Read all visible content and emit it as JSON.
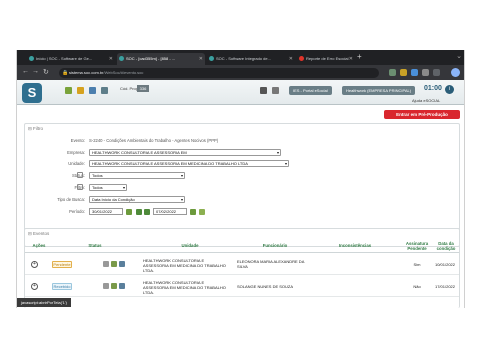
{
  "browser": {
    "tabs": [
      {
        "label": "Início | SOC - Software de Ge..."
      },
      {
        "label": "SOC - [cad355m] - [858 - ..."
      },
      {
        "label": "SOC - Software Integrado de..."
      },
      {
        "label": "Reporte de Erro Esocial"
      }
    ],
    "url_host": "sistema.soc.com.br",
    "url_path": "/WebSoc/#/evento.soc"
  },
  "header": {
    "logo_letter": "S",
    "cod_prog_label": "Cód. Prog.",
    "cod_prog_value": "336",
    "esocial_label": "IES - Portal eSocial",
    "company_label": "Healthwork (EMPRESA PRINCIPAL)",
    "clock": "01:00",
    "help_link": "Ajuda eSOCIAL"
  },
  "actions": {
    "entrar_button": "Entrar em Pré-Produção"
  },
  "filter": {
    "title": "Filtro",
    "evento_label": "Evento:",
    "evento_value": "S-2240 - Condições Ambientais do Trabalho - Agentes Nocivos (PPP)",
    "empresa_label": "Empresa:",
    "empresa_value": "HEALTHWORK CONSULTORIA E ASSESSORIA EM",
    "unidade_label": "Unidade:",
    "unidade_value": "HEALTHWORK CONSULTORIA E ASSESSORIA EM MEDICINA DO TRABALHO LTDA",
    "status_label": "Status:",
    "status_value": "Todos",
    "filtro_label": "Filtro:",
    "filtro_value": "Todos",
    "tipo_busca_label": "Tipo de Busca:",
    "tipo_busca_value": "Data Início da Condição",
    "periodo_label": "Período:",
    "periodo_start": "30/01/2022",
    "periodo_end": "07/02/2022"
  },
  "events": {
    "title": "Eventos",
    "columns": {
      "acoes": "Ações",
      "status": "Status",
      "unidade": "Unidade",
      "funcionario": "Funcionário",
      "inconsistencias": "Inconsistências",
      "assinatura": "Assinatura Pendente",
      "data": "Data da condição"
    },
    "rows": [
      {
        "status": "Pendente",
        "unidade": "HEALTHWORK CONSULTORIA E ASSESSORIA EM MEDICINA DO TRABALHO LTDA.",
        "funcionario": "ELEONORA MARIA ALEXANDRE DA SILVA",
        "inconsistencias": "",
        "assinatura": "Sim",
        "data": "10/01/2022"
      },
      {
        "status": "Recebido",
        "unidade": "HEALTHWORK CONSULTORIA E ASSESSORIA EM MEDICINA DO TRABALHO LTDA.",
        "funcionario": "SOLANGE NUNES DE SOUZA",
        "inconsistencias": "",
        "assinatura": "Não",
        "data": "17/01/2022"
      }
    ]
  },
  "status_bar": "javascript:abrirPorTela('1')",
  "colors": {
    "brand": "#2f6f8f",
    "danger_button": "#d9272e",
    "table_header_text": "#2f7a43"
  }
}
